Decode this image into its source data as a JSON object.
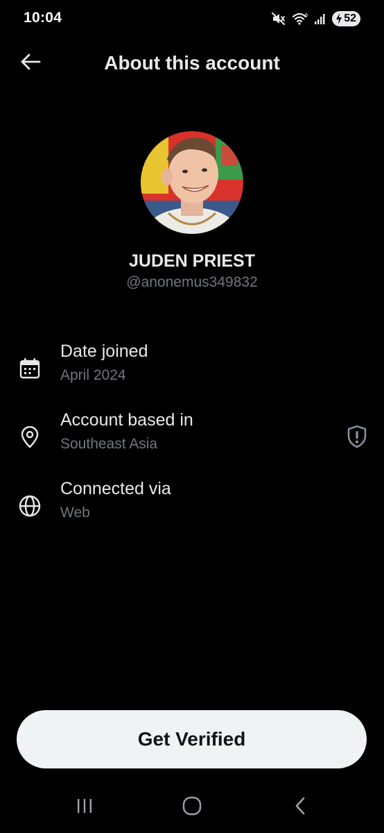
{
  "status_bar": {
    "time": "10:04",
    "battery_level": "52",
    "icons": [
      "mute-icon",
      "wifi-icon",
      "signal-icon",
      "battery-charging-icon"
    ]
  },
  "header": {
    "title": "About this account",
    "back_icon": "arrow-left-icon"
  },
  "profile": {
    "name": "JUDEN PRIEST",
    "handle": "@anonemus349832"
  },
  "info": [
    {
      "label": "Date joined",
      "value": "April 2024",
      "icon": "calendar-icon"
    },
    {
      "label": "Account based in",
      "value": "Southeast Asia",
      "icon": "location-pin-icon",
      "badge_icon": "shield-alert-icon"
    },
    {
      "label": "Connected via",
      "value": "Web",
      "icon": "globe-icon"
    }
  ],
  "cta": {
    "label": "Get Verified"
  },
  "nav": {
    "icons": [
      "recents-icon",
      "home-icon",
      "back-icon"
    ]
  },
  "colors": {
    "background": "#000000",
    "primary_text": "#e7e9ea",
    "secondary_text": "#71767b",
    "button_bg": "#eff3f4",
    "button_text": "#0f1419"
  }
}
